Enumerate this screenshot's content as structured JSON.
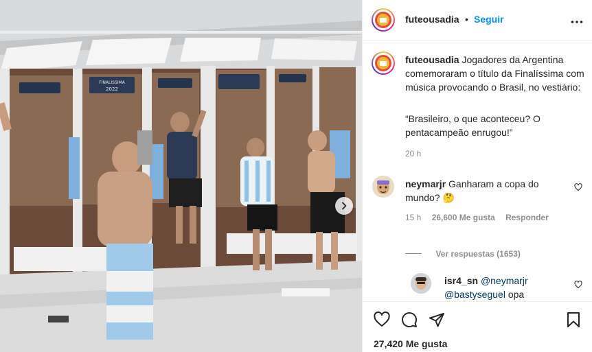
{
  "post": {
    "username": "futeousadia",
    "follow_label": "Seguir",
    "separator": "•"
  },
  "caption": {
    "username": "futeousadia",
    "text": "Jogadores da Argentina comemoraram o título da Finalíssima com música provocando o Brasil, no vestiário:",
    "quote": "“Brasileiro, o que aconteceu? O pentacampeão enrugou!”",
    "time": "20 h"
  },
  "comment": {
    "username": "neymarjr",
    "text": "Ganharam a copa do mundo? 🤔",
    "time": "15 h",
    "likes": "26,600 Me gusta",
    "reply_label": "Responder",
    "view_replies": "Ver respuestas (1653)"
  },
  "reply": {
    "username": "isr4_sn",
    "mention1": "@neymarjr",
    "mention2": "@bastyseguel",
    "text": "opa"
  },
  "media": {
    "banner_label": "FINALISSIMA",
    "banner_year": "2022"
  },
  "likes_total": "27,420 Me gusta",
  "icons": {
    "more": "more-horizontal-icon",
    "heart": "heart-icon",
    "comment": "comment-icon",
    "share": "share-icon",
    "save": "bookmark-icon",
    "next": "chevron-right-icon"
  },
  "colors": {
    "link": "#0095f6",
    "mention": "#00376b",
    "muted": "#8e8e8e"
  }
}
